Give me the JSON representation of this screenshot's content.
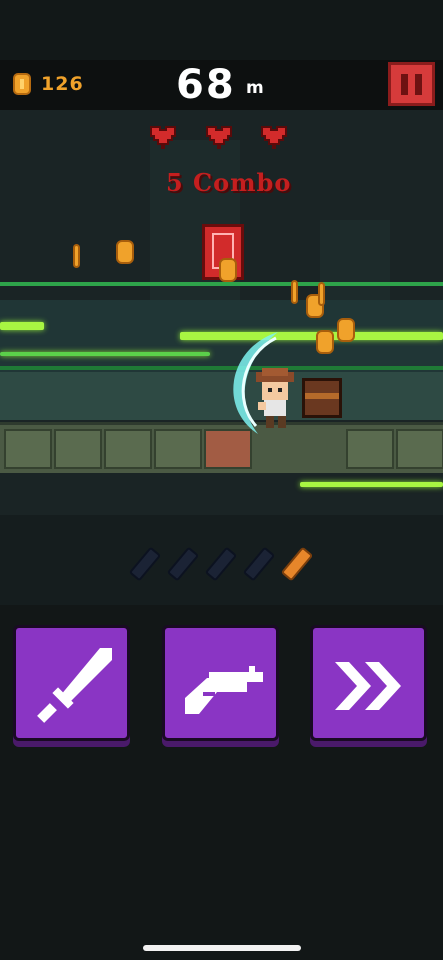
{
  "hud": {
    "coin_count": "126",
    "distance": "68",
    "distance_unit": "m"
  },
  "hearts": {
    "count": 3,
    "color": "#d32b2b"
  },
  "combo_text": "5 Combo",
  "ammo": {
    "total": 5,
    "loaded": 1
  },
  "actions": [
    {
      "id": "sword",
      "icon": "sword-icon"
    },
    {
      "id": "gun",
      "icon": "revolver-icon"
    },
    {
      "id": "dash",
      "icon": "double-chevron-icon"
    }
  ],
  "colors": {
    "accent": "#8a35c4",
    "coin": "#f0a22b",
    "pause": "#d63b3b",
    "combo": "#c41f1f",
    "speed_streak": "#a8f542"
  }
}
